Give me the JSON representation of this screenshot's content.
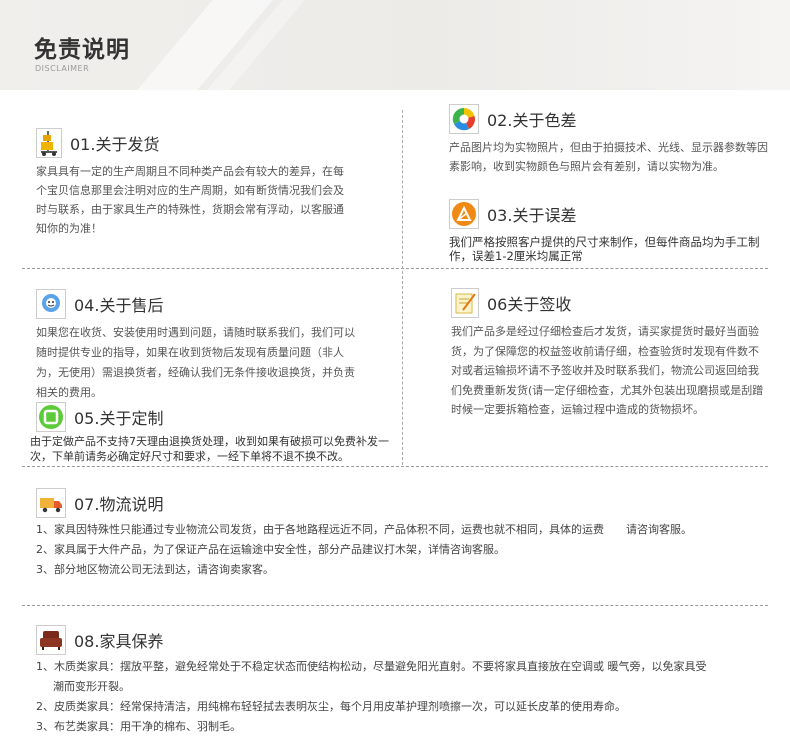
{
  "header": {
    "title": "免责说明",
    "subtitle": "DISCLAIMER"
  },
  "sections": {
    "s01": {
      "title": "01.关于发货",
      "icon": "forklift-icon",
      "body": "家具具有一定的生产周期且不同种类产品会有较大的差异，在每个宝贝信息那里会注明对应的生产周期，如有断货情况我们会及时与联系，由于家具生产的特殊性，货期会常有浮动，以客服通知你的为准！"
    },
    "s02": {
      "title": "02.关于色差",
      "icon": "color-wheel-icon",
      "body": "产品图片均为实物照片，但由于拍摄技术、光线、显示器参数等因素影响，收到实物颜色与照片会有差别，请以实物为准。"
    },
    "s03": {
      "title": "03.关于误差",
      "icon": "ruler-triangle-icon",
      "body": "我们严格按照客户提供的尺寸来制作，但每件商品均为手工制作，误差1-2厘米均属正常"
    },
    "s04": {
      "title": "04.关于售后",
      "icon": "support-globe-icon",
      "body": "如果您在收货、安装使用时遇到问题，请随时联系我们，我们可以随时提供专业的指导，如果在收到货物后发现有质量问题（非人为，无使用）需退换货者，经确认我们无条件接收退换货，并负责相关的费用。"
    },
    "s05": {
      "title": "05.关于定制",
      "icon": "custom-green-icon",
      "body": "由于定做产品不支持7天理由退换货处理，收到如果有破损可以免费补发一次，下单前请务必确定好尺寸和要求，一经下单将不退不换不改。"
    },
    "s06": {
      "title": "06关于签收",
      "icon": "sign-note-icon",
      "body": "我们产品多是经过仔细检查后才发货，请买家提货时最好当面验货，为了保障您的权益签收前请仔细，检查验货时发现有件数不对或者运输损坏请不予签收并及时联系我们，物流公司返回给我们免费重新发货(请一定仔细检查，尤其外包装出现磨损或是刮蹭时候一定要拆箱检查，运输过程中造成的货物损坏。"
    },
    "s07": {
      "title": "07.物流说明",
      "icon": "delivery-truck-icon",
      "items": [
        "1、家具因特殊性只能通过专业物流公司发货，由于各地路程远近不同，产品体积不同，运费也就不相同，具体的运费　　请咨询客服。",
        "2、家具属于大件产品，为了保证产品在运输途中安全性，部分产品建议打木架，详情咨询客服。",
        "3、部分地区物流公司无法到达，请咨询卖家客。"
      ]
    },
    "s08": {
      "title": "08.家具保养",
      "icon": "sofa-chair-icon",
      "items": [
        "1、木质类家具：摆放平整，避免经常处于不稳定状态而使结构松动，尽量避免阳光直射。不要将家具直接放在空调或 暖气旁，以免家具受",
        "潮而变形开裂。",
        "2、皮质类家具：经常保持清洁，用纯棉布轻轻拭去表明灰尘，每个月用皮革护理剂喷擦一次，可以延长皮革的使用寿命。",
        "3、布艺类家具：用干净的棉布、羽制毛。"
      ]
    }
  }
}
